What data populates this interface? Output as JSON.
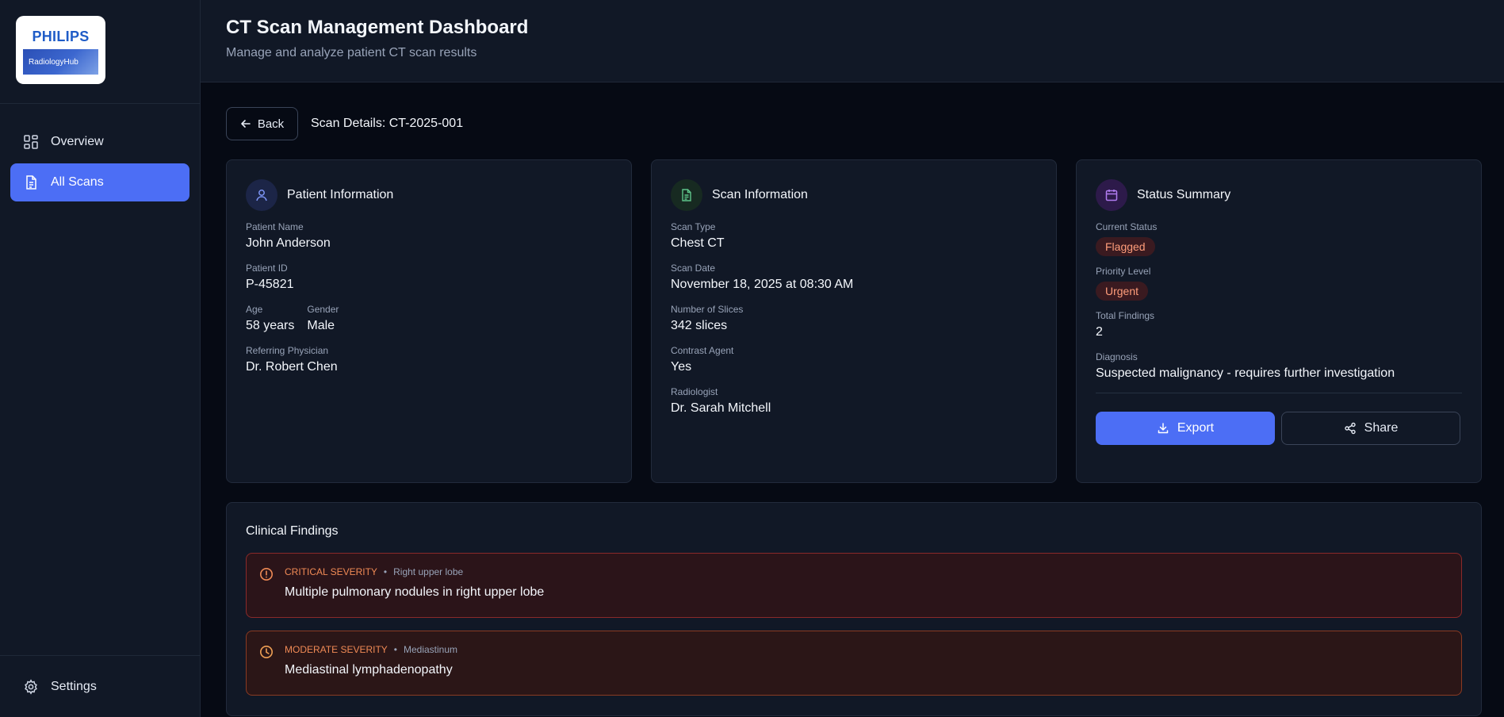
{
  "brand": {
    "name": "PHILIPS",
    "product": "RadiologyHub"
  },
  "sidebar": {
    "items": [
      {
        "label": "Overview",
        "icon": "dashboard-grid-icon",
        "active": false
      },
      {
        "label": "All Scans",
        "icon": "document-icon",
        "active": true
      }
    ],
    "footer": {
      "label": "Settings",
      "icon": "gear-icon"
    }
  },
  "header": {
    "title": "CT Scan Management Dashboard",
    "subtitle": "Manage and analyze patient CT scan results"
  },
  "detail": {
    "back_label": "Back",
    "title": "Scan Details: CT-2025-001"
  },
  "patient": {
    "title": "Patient Information",
    "name_label": "Patient Name",
    "name": "John Anderson",
    "id_label": "Patient ID",
    "id": "P-45821",
    "age_label": "Age",
    "age": "58 years",
    "gender_label": "Gender",
    "gender": "Male",
    "physician_label": "Referring Physician",
    "physician": "Dr. Robert Chen"
  },
  "scan": {
    "title": "Scan Information",
    "type_label": "Scan Type",
    "type": "Chest CT",
    "date_label": "Scan Date",
    "date": "November 18, 2025 at 08:30 AM",
    "slices_label": "Number of Slices",
    "slices": "342 slices",
    "contrast_label": "Contrast Agent",
    "contrast": "Yes",
    "radiologist_label": "Radiologist",
    "radiologist": "Dr. Sarah Mitchell"
  },
  "status": {
    "title": "Status Summary",
    "current_label": "Current Status",
    "current": "Flagged",
    "priority_label": "Priority Level",
    "priority": "Urgent",
    "findings_label": "Total Findings",
    "findings": "2",
    "diagnosis_label": "Diagnosis",
    "diagnosis": "Suspected malignancy - requires further investigation",
    "export_label": "Export",
    "share_label": "Share"
  },
  "findings": {
    "title": "Clinical Findings",
    "items": [
      {
        "severity": "CRITICAL SEVERITY",
        "location": "Right upper lobe",
        "text": "Multiple pulmonary nodules in right upper lobe",
        "icon": "alert-circle-icon"
      },
      {
        "severity": "MODERATE SEVERITY",
        "location": "Mediastinum",
        "text": "Mediastinal lymphadenopathy",
        "icon": "clock-icon"
      }
    ]
  },
  "colors": {
    "accent": "#4c6ef5",
    "background": "#060a14",
    "panel": "#111826",
    "critical_border": "#8a2a2a",
    "severity_text": "#f08a55"
  }
}
